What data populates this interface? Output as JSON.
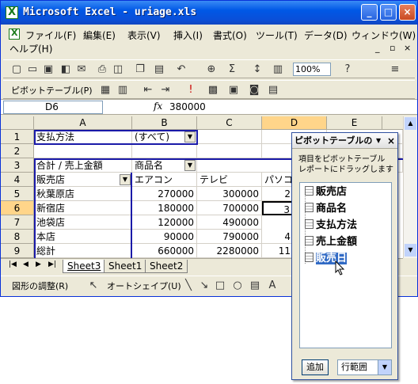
{
  "window": {
    "title": "Microsoft Excel - uriage.xls",
    "min": "_",
    "max": "□",
    "close": "×"
  },
  "menu": {
    "items": [
      "ファイル(F)",
      "編集(E)",
      "表示(V)",
      "挿入(I)",
      "書式(O)",
      "ツール(T)",
      "データ(D)",
      "ウィンドウ(W)"
    ],
    "help": "ヘルプ(H)",
    "doc_min": "_",
    "doc_restore": "▫",
    "doc_close": "×"
  },
  "toolbar": {
    "zoom": "100%",
    "pivot_label": "ピボットテーブル(P)"
  },
  "formula": {
    "cell_ref": "D6",
    "fx": "fx",
    "value": "380000"
  },
  "grid": {
    "columns": [
      "A",
      "B",
      "C",
      "D",
      "E"
    ],
    "rows": [
      "1",
      "2",
      "3",
      "4",
      "5",
      "6",
      "7",
      "8",
      "9"
    ],
    "cells": {
      "r1": {
        "a": "支払方法",
        "b": "(すべて)"
      },
      "r3": {
        "a": "合計 / 売上金額",
        "b": "商品名"
      },
      "r4": {
        "a": "販売店",
        "b": "エアコン",
        "c": "テレビ",
        "d": "パソコ"
      },
      "r5": {
        "a": "秋葉原店",
        "b": "270000",
        "c": "300000",
        "d": "2"
      },
      "r6": {
        "a": "新宿店",
        "b": "180000",
        "c": "700000",
        "d": "3"
      },
      "r7": {
        "a": "池袋店",
        "b": "120000",
        "c": "490000",
        "d": ""
      },
      "r8": {
        "a": "本店",
        "b": "90000",
        "c": "790000",
        "d": "4"
      },
      "r9": {
        "a": "総計",
        "b": "660000",
        "c": "2280000",
        "d": "11"
      }
    }
  },
  "sheets": {
    "tabs": [
      "Sheet3",
      "Sheet1",
      "Sheet2"
    ],
    "active": "Sheet3"
  },
  "drawbar": {
    "adjust": "図形の調整(R)",
    "autoshape": "オートシェイプ(U)"
  },
  "pivot_pane": {
    "title": "ピボットテーブルの",
    "desc": "項目をピボットテーブル レポートにドラッグします",
    "fields": [
      "販売店",
      "商品名",
      "支払方法",
      "売上金額",
      "販売日"
    ],
    "selected": "販売日",
    "add_button": "追加",
    "area": "行範囲"
  }
}
